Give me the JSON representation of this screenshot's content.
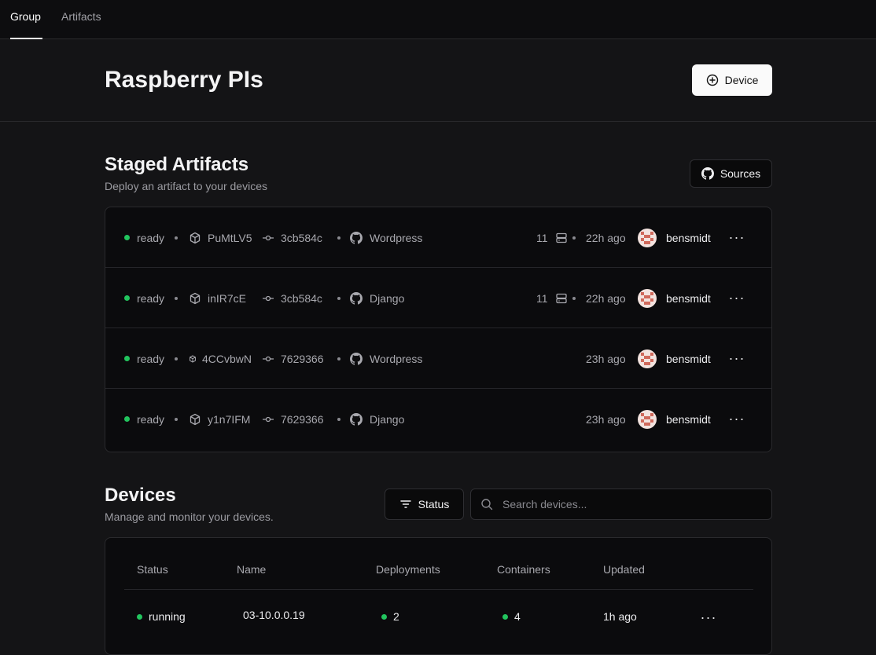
{
  "nav": {
    "tabs": [
      {
        "label": "Group",
        "active": true
      },
      {
        "label": "Artifacts",
        "active": false
      }
    ]
  },
  "header": {
    "title": "Raspberry PIs",
    "add_device_label": "Device"
  },
  "staged": {
    "title": "Staged Artifacts",
    "subtitle": "Deploy an artifact to your devices",
    "sources_label": "Sources",
    "rows": [
      {
        "status": "ready",
        "artifact_id": "PuMtLV5",
        "commit": "3cb584c",
        "repo": "Wordpress",
        "count": "11",
        "time": "22h ago",
        "user": "bensmidt"
      },
      {
        "status": "ready",
        "artifact_id": "inIR7cE",
        "commit": "3cb584c",
        "repo": "Django",
        "count": "11",
        "time": "22h ago",
        "user": "bensmidt"
      },
      {
        "status": "ready",
        "artifact_id": "4CCvbwN",
        "commit": "7629366",
        "repo": "Wordpress",
        "count": "",
        "time": "23h ago",
        "user": "bensmidt"
      },
      {
        "status": "ready",
        "artifact_id": "y1n7IFM",
        "commit": "7629366",
        "repo": "Django",
        "count": "",
        "time": "23h ago",
        "user": "bensmidt"
      }
    ]
  },
  "devices": {
    "title": "Devices",
    "subtitle": "Manage and monitor your devices.",
    "status_filter_label": "Status",
    "search_placeholder": "Search devices...",
    "columns": [
      "Status",
      "Name",
      "Deployments",
      "Containers",
      "Updated"
    ],
    "rows": [
      {
        "status": "running",
        "name": "03-10.0.0.19",
        "deployments": "2",
        "containers": "4",
        "updated": "1h ago"
      }
    ]
  },
  "colors": {
    "background": "#141416",
    "card": "#0b0b0d",
    "accent_green": "#22c55e",
    "avatar": "#d06a5c"
  }
}
